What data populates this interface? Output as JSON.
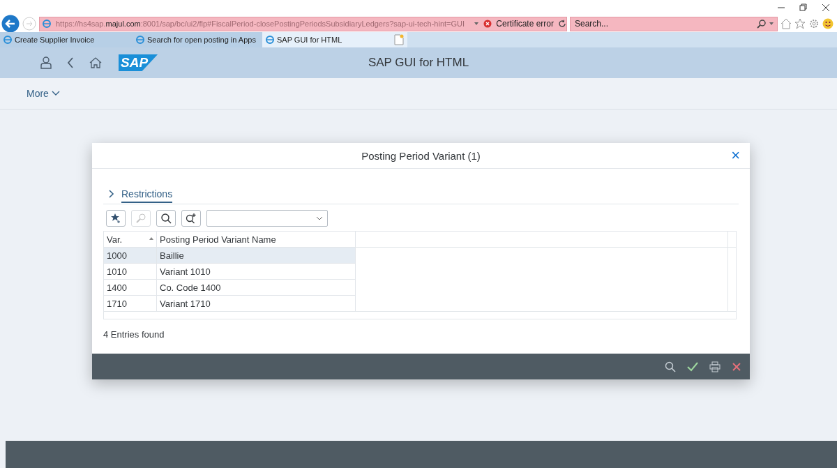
{
  "browser": {
    "url": "https://hs4sap.**majul.com**:8001/sap/bc/ui2/flp#FiscalPeriod-closePostingPeriodsSubsidiaryLedgers?sap-ui-tech-hint=GUI",
    "certificate": "Certificate error",
    "search": {
      "placeholder": "Search..."
    },
    "tabs": [
      {
        "label": "Create Supplier Invoice",
        "selected": false
      },
      {
        "label": "Search for open posting in Apps",
        "selected": false
      },
      {
        "label": "SAP GUI for HTML",
        "selected": true
      }
    ]
  },
  "shell": {
    "logo": "SAP",
    "title": "SAP GUI for HTML",
    "more": "More"
  },
  "dialog": {
    "title": "Posting Period Variant (1)",
    "close": "×",
    "section": "Restrictions",
    "table": {
      "columns": [
        "Var.",
        "Posting Period Variant Name"
      ],
      "rows": [
        {
          "cells": [
            "1000",
            "Baillie"
          ],
          "selected": true
        },
        {
          "cells": [
            "1010",
            "Variant 1010"
          ],
          "selected": false
        },
        {
          "cells": [
            "1400",
            "Co. Code 1400"
          ],
          "selected": false
        },
        {
          "cells": [
            "1710",
            "Variant 1710"
          ],
          "selected": false
        }
      ]
    },
    "status": "4 Entries found"
  }
}
